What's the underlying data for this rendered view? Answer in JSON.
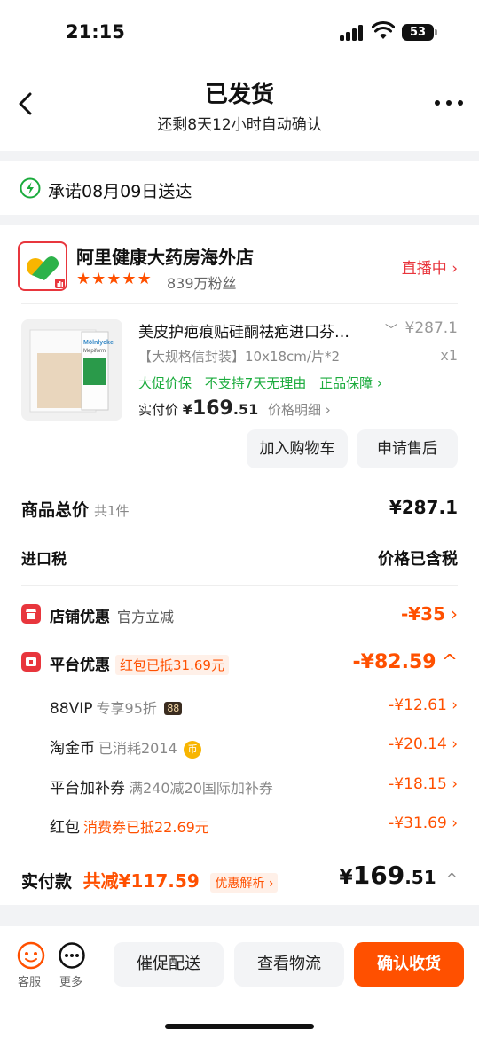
{
  "status": {
    "time": "21:15",
    "battery": "53"
  },
  "header": {
    "title": "已发货",
    "subtitle": "还剩8天12小时自动确认"
  },
  "delivery": {
    "text": "承诺08月09日送达"
  },
  "shop": {
    "name": "阿里健康大药房海外店",
    "rating_stars": 5,
    "fans": "839万粉丝",
    "live": "直播中 ›"
  },
  "product": {
    "title": "美皮护疤痕贴硅酮祛疤进口芬…",
    "price": "¥287.1",
    "spec": "【大规格信封装】10x18cm/片*2",
    "qty": "x1",
    "tags": [
      "大促价保",
      "不支持7天无理由",
      "正品保障 ›"
    ],
    "pay_label": "实付价",
    "pay_yen": "¥",
    "pay_int": "169",
    "pay_dec": ".51",
    "price_detail": "价格明细 ›",
    "brand_text": "Mölnlycke",
    "brand_sub": "Mepiform"
  },
  "actions": {
    "add_cart": "加入购物车",
    "after_sale": "申请售后"
  },
  "summary": {
    "total_label": "商品总价",
    "total_count": "共1件",
    "total_value": "¥287.1",
    "tax_label": "进口税",
    "tax_value": "价格已含税"
  },
  "discounts": {
    "shop": {
      "label": "店铺优惠",
      "sub": "官方立减",
      "value": "-¥35",
      "chev": "›"
    },
    "platform": {
      "label": "平台优惠",
      "badge": "红包已抵31.69元",
      "value": "-¥82.59",
      "chev": "^"
    },
    "items": [
      {
        "name": "88VIP",
        "sub": "专享95折",
        "badge": "88",
        "value": "-¥12.61 ›"
      },
      {
        "name": "淘金币",
        "sub": "已消耗2014",
        "badge": "币",
        "value": "-¥20.14 ›"
      },
      {
        "name": "平台加补券",
        "sub": "满240减20国际加补券",
        "value": "-¥18.15 ›"
      },
      {
        "name": "红包",
        "sub": "消费券已抵22.69元",
        "value": "-¥31.69 ›"
      }
    ]
  },
  "paid": {
    "label": "实付款",
    "saved": "共减¥117.59",
    "analysis": "优惠解析 ›",
    "yen": "¥",
    "int": "169",
    "dec": ".51",
    "chev": "^"
  },
  "bottom": {
    "service": "客服",
    "more": "更多",
    "urge": "催促配送",
    "logistics": "查看物流",
    "confirm": "确认收货"
  },
  "colors": {
    "accent": "#ff5000",
    "red": "#e8363d",
    "green": "#1aab3c"
  }
}
